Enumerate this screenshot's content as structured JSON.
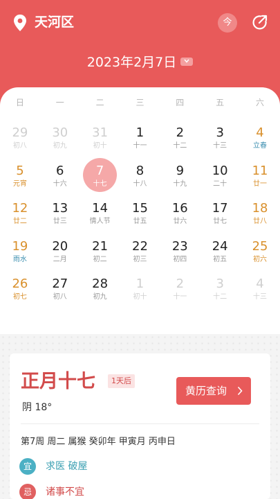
{
  "header": {
    "location": "天河区",
    "today_label": "今",
    "date_title": "2023年2月7日",
    "accent_color": "#e85a5a",
    "icons": [
      "location-pin-icon",
      "share-icon",
      "chevron-down-icon"
    ]
  },
  "calendar": {
    "weekdays": [
      "日",
      "一",
      "二",
      "三",
      "四",
      "五",
      "六"
    ],
    "weeks": [
      [
        {
          "d": "29",
          "l": "初八",
          "other": true
        },
        {
          "d": "30",
          "l": "初九",
          "other": true
        },
        {
          "d": "31",
          "l": "初十",
          "other": true
        },
        {
          "d": "1",
          "l": "十一"
        },
        {
          "d": "2",
          "l": "十二"
        },
        {
          "d": "3",
          "l": "十三"
        },
        {
          "d": "4",
          "l": "立春",
          "term": true
        }
      ],
      [
        {
          "d": "5",
          "l": "元宵",
          "fest": true
        },
        {
          "d": "6",
          "l": "十六"
        },
        {
          "d": "7",
          "l": "十七",
          "selected": true
        },
        {
          "d": "8",
          "l": "十八"
        },
        {
          "d": "9",
          "l": "十九"
        },
        {
          "d": "10",
          "l": "二十"
        },
        {
          "d": "11",
          "l": "廿一"
        }
      ],
      [
        {
          "d": "12",
          "l": "廿二"
        },
        {
          "d": "13",
          "l": "廿三"
        },
        {
          "d": "14",
          "l": "情人节"
        },
        {
          "d": "15",
          "l": "廿五"
        },
        {
          "d": "16",
          "l": "廿六"
        },
        {
          "d": "17",
          "l": "廿七"
        },
        {
          "d": "18",
          "l": "廿八"
        }
      ],
      [
        {
          "d": "19",
          "l": "雨水",
          "term": true
        },
        {
          "d": "20",
          "l": "二月"
        },
        {
          "d": "21",
          "l": "初二"
        },
        {
          "d": "22",
          "l": "初三"
        },
        {
          "d": "23",
          "l": "初四"
        },
        {
          "d": "24",
          "l": "初五"
        },
        {
          "d": "25",
          "l": "初六"
        }
      ],
      [
        {
          "d": "26",
          "l": "初七"
        },
        {
          "d": "27",
          "l": "初八"
        },
        {
          "d": "28",
          "l": "初九"
        },
        {
          "d": "1",
          "l": "初十",
          "other": true
        },
        {
          "d": "2",
          "l": "十一",
          "other": true
        },
        {
          "d": "3",
          "l": "十二",
          "other": true
        },
        {
          "d": "4",
          "l": "十三",
          "other": true
        }
      ]
    ]
  },
  "detail": {
    "lunar_date": "正月十七",
    "days_badge": "1天后",
    "weather": "阴 18°",
    "huangli_label": "黄历查询",
    "info_line": "第7周 周二 属猴 癸卯年 甲寅月 丙申日",
    "yi_label": "宜",
    "yi_text": "求医 破屋",
    "ji_label": "忌",
    "ji_text": "诸事不宜"
  }
}
